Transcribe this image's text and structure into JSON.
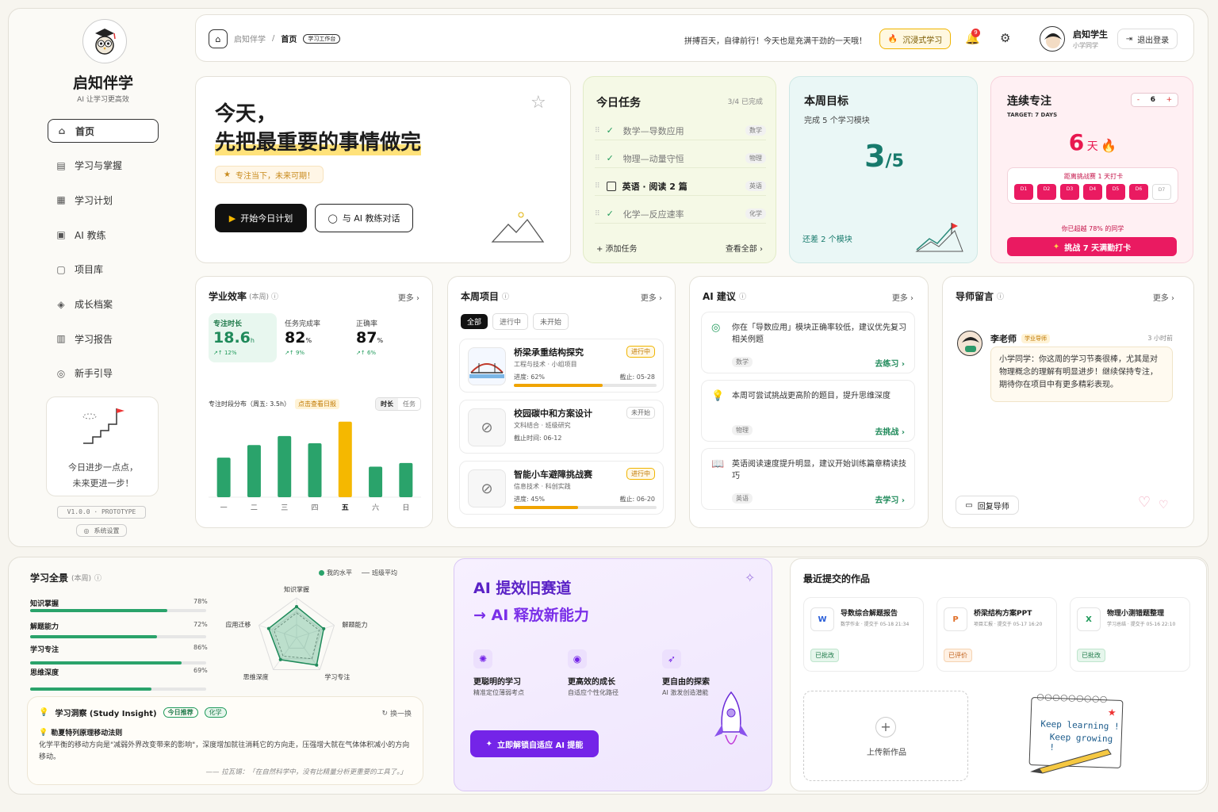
{
  "brand": {
    "name": "启知伴学",
    "slogan": "AI 让学习更高效",
    "version": "V1.0.0 · PROTOTYPE",
    "settings": "系统设置",
    "motto_line1": "今日进步一点点，",
    "motto_line2": "未来更进一步！"
  },
  "nav": [
    {
      "label": "首页",
      "icon": "home-icon",
      "active": true
    },
    {
      "label": "学习与掌握",
      "icon": "book-icon"
    },
    {
      "label": "学习计划",
      "icon": "calendar-icon"
    },
    {
      "label": "AI 教练",
      "icon": "ai-coach-icon"
    },
    {
      "label": "项目库",
      "icon": "folder-icon"
    },
    {
      "label": "成长档案",
      "icon": "graduation-icon"
    },
    {
      "label": "学习报告",
      "icon": "report-icon"
    },
    {
      "label": "新手引导",
      "icon": "compass-icon"
    }
  ],
  "header": {
    "breadcrumb_root": "启知伴学",
    "breadcrumb_sep": "/",
    "breadcrumb_current": "首页",
    "badge": "学习工作台",
    "greeting": "拼搏百天，自律前行！今天也是充满干劲的一天哦！",
    "immersive": "沉浸式学习",
    "notif_count": "9",
    "user_name": "启知学生",
    "user_role": "小学同学",
    "logout": "退出登录"
  },
  "hero": {
    "line1": "今天，",
    "line2": "先把最重要的事情做完",
    "tip": "专注当下，未来可期！",
    "start": "开始今日计划",
    "chat": "与 AI 教练对话"
  },
  "tasks": {
    "title": "今日任务",
    "progress": "3/4  已完成",
    "items": [
      {
        "label": "数学—导数应用",
        "tag": "数学",
        "done": true
      },
      {
        "label": "物理—动量守恒",
        "tag": "物理",
        "done": true
      },
      {
        "label": "英语 · 阅读 2 篇",
        "tag": "英语",
        "done": false
      },
      {
        "label": "化学—反应速率",
        "tag": "化学",
        "done": true
      }
    ],
    "add": "+ 添加任务",
    "all": "查看全部 ›"
  },
  "goal": {
    "title": "本周目标",
    "sub": "完成 5 个学习模块",
    "done": "3",
    "total": "/5",
    "remain": "还差 2 个模块"
  },
  "streak": {
    "title": "连续专注",
    "target": "TARGET: 7 DAYS",
    "minus": "-",
    "value": "6",
    "plus": "+",
    "days": "6",
    "unit": "天",
    "challenge": "距离挑战赛 1 天打卡",
    "cells": [
      "D1",
      "D2",
      "D3",
      "D4",
      "D5",
      "D6",
      "D7"
    ],
    "beat": "你已超越 78% 的同学",
    "cta": "挑战 7 天满勤打卡"
  },
  "efficiency": {
    "title": "学业效率",
    "period": "(本周)",
    "more": "更多 ›",
    "stats": [
      {
        "label": "专注时长",
        "value": "18.6",
        "unit": "h",
        "delta": "↗↑ 12%"
      },
      {
        "label": "任务完成率",
        "value": "82",
        "unit": "%",
        "delta": "↗↑ 9%"
      },
      {
        "label": "正确率",
        "value": "87",
        "unit": "%",
        "delta": "↗↑ 6%"
      }
    ],
    "dist": "专注时段分布（周五: 3.5h）",
    "hint": "点击查看日报",
    "toggle": [
      "时长",
      "任务"
    ]
  },
  "chart_data": {
    "type": "bar",
    "categories": [
      "一",
      "二",
      "三",
      "四",
      "五",
      "六",
      "日"
    ],
    "values": [
      2.2,
      2.9,
      3.4,
      3.0,
      4.2,
      1.7,
      1.9
    ],
    "highlight": "五",
    "colors": {
      "normal": "#2aa36b",
      "highlight": "#f5b800"
    }
  },
  "projects": {
    "title": "本周项目",
    "more": "更多 ›",
    "filters": [
      "全部",
      "进行中",
      "未开始"
    ],
    "items": [
      {
        "name": "桥梁承重结构探究",
        "meta": "工程与技术 · 小组项目",
        "status": "进行中",
        "progress": "进度: 62%",
        "deadline": "截止: 05-28",
        "pct": 62
      },
      {
        "name": "校园碳中和方案设计",
        "meta": "文科结合 · 班级研究",
        "status": "未开始",
        "progress": "截止时间: 06-12",
        "deadline": "",
        "pct": 0
      },
      {
        "name": "智能小车避障挑战赛",
        "meta": "信息技术 · 科创实践",
        "status": "进行中",
        "progress": "进度: 45%",
        "deadline": "截止: 06-20",
        "pct": 45
      }
    ]
  },
  "ai": {
    "title": "AI 建议",
    "more": "更多 ›",
    "items": [
      {
        "text": "你在「导数应用」模块正确率较低，建议优先复习相关例题",
        "tag": "数学",
        "action": "去练习 ›"
      },
      {
        "text": "本周可尝试挑战更高阶的题目，提升思维深度",
        "tag": "物理",
        "action": "去挑战 ›"
      },
      {
        "text": "英语阅读速度提升明显，建议开始训练篇章精读技巧",
        "tag": "英语",
        "action": "去学习 ›"
      }
    ]
  },
  "mentor": {
    "title": "导师留言",
    "more": "更多 ›",
    "name": "李老师",
    "role": "学业导师",
    "time": "3 小时前",
    "msg": "小学同学：你这周的学习节奏很棒，尤其是对物理概念的理解有明显进步！继续保持专注，期待你在项目中有更多精彩表现。",
    "reply": "回复导师"
  },
  "overview": {
    "title": "学习全景",
    "period": "(本周)",
    "legend_mine": "我的水平",
    "legend_avg": "班级平均",
    "skills": [
      {
        "label": "知识掌握",
        "pct": 78,
        "text": "78%"
      },
      {
        "label": "解题能力",
        "pct": 72,
        "text": "72%"
      },
      {
        "label": "学习专注",
        "pct": 86,
        "text": "86%"
      },
      {
        "label": "思维深度",
        "pct": 69,
        "text": "69%"
      }
    ],
    "radar_labels": [
      "知识掌握",
      "解题能力",
      "学习专注",
      "思维深度",
      "应用迁移"
    ],
    "radar_mine": [
      0.78,
      0.72,
      0.86,
      0.69,
      0.74
    ],
    "radar_avg": [
      0.62,
      0.6,
      0.66,
      0.58,
      0.6
    ]
  },
  "insight": {
    "title": "学习洞察 (Study Insight)",
    "badge1": "今日推荐",
    "badge2": "化学",
    "refresh": "换一换",
    "head": "勒夏特列原理移动法则",
    "body": "化学平衡的移动方向是\"减弱外界改变带来的影响\"，深度增加就往消耗它的方向走，压强增大就在气体体积减小的方向移动。",
    "quote": "—— 拉瓦锡：「在自然科学中，没有比精量分析更重要的工具了。」"
  },
  "promo": {
    "line1": "AI 提效旧赛道",
    "line2": "→  AI 释放新能力",
    "features": [
      {
        "title": "更聪明的学习",
        "sub": "精准定位薄弱考点"
      },
      {
        "title": "更高效的成长",
        "sub": "自适应个性化路径"
      },
      {
        "title": "更自由的探索",
        "sub": "AI 激发创造潜能"
      }
    ],
    "cta": "立即解锁自适应 AI 提能"
  },
  "works": {
    "title": "最近提交的作品",
    "items": [
      {
        "icon": "W",
        "name": "导数综合解题报告",
        "meta": "数学作业 · 提交于 05-18 21:34",
        "status": "已批改",
        "color": "#2b5fd9"
      },
      {
        "icon": "P",
        "name": "桥梁结构方案PPT",
        "meta": "项目汇报 · 提交于 05-17 16:20",
        "status": "已评价",
        "color": "#e0702a"
      },
      {
        "icon": "X",
        "name": "物理小测错题整理",
        "meta": "学习总结 · 提交于 05-16 22:10",
        "status": "已批改",
        "color": "#1f9a5a"
      }
    ],
    "upload": "上传新作品",
    "note1": "Keep learning !",
    "note2": "Keep growing !"
  }
}
